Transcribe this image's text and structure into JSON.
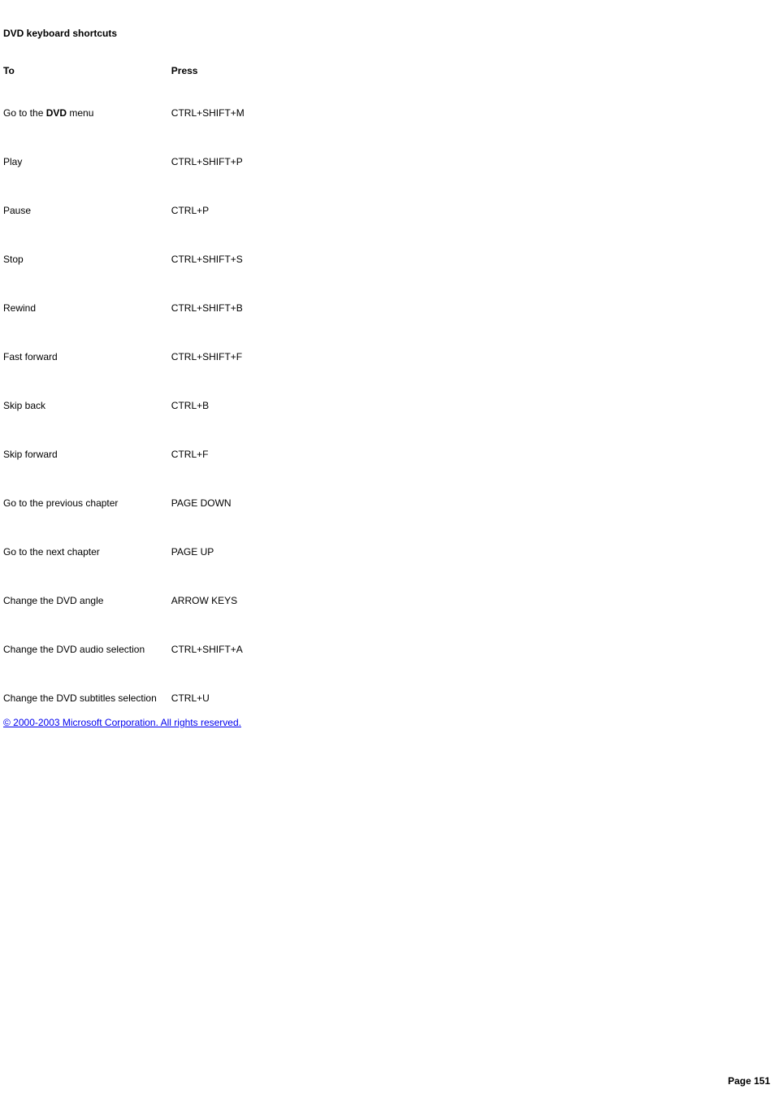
{
  "title": "DVD keyboard shortcuts",
  "table": {
    "headers": {
      "to": "To",
      "press": "Press"
    },
    "rows": [
      {
        "to_pre": "Go to the ",
        "to_bold": "DVD",
        "to_post": " menu",
        "press": "CTRL+SHIFT+M"
      },
      {
        "to_pre": "Play",
        "to_bold": "",
        "to_post": "",
        "press": "CTRL+SHIFT+P"
      },
      {
        "to_pre": "Pause",
        "to_bold": "",
        "to_post": "",
        "press": "CTRL+P"
      },
      {
        "to_pre": "Stop",
        "to_bold": "",
        "to_post": "",
        "press": "CTRL+SHIFT+S"
      },
      {
        "to_pre": "Rewind",
        "to_bold": "",
        "to_post": "",
        "press": "CTRL+SHIFT+B"
      },
      {
        "to_pre": "Fast forward",
        "to_bold": "",
        "to_post": "",
        "press": "CTRL+SHIFT+F"
      },
      {
        "to_pre": "Skip back",
        "to_bold": "",
        "to_post": "",
        "press": "CTRL+B"
      },
      {
        "to_pre": "Skip forward",
        "to_bold": "",
        "to_post": "",
        "press": "CTRL+F"
      },
      {
        "to_pre": "Go to the previous chapter",
        "to_bold": "",
        "to_post": "",
        "press": "PAGE DOWN"
      },
      {
        "to_pre": "Go to the next chapter",
        "to_bold": "",
        "to_post": "",
        "press": "PAGE UP"
      },
      {
        "to_pre": "Change the DVD angle",
        "to_bold": "",
        "to_post": "",
        "press": "ARROW KEYS"
      },
      {
        "to_pre": "Change the DVD audio selection",
        "to_bold": "",
        "to_post": "",
        "press": "CTRL+SHIFT+A"
      },
      {
        "to_pre": "Change the DVD subtitles selection",
        "to_bold": "",
        "to_post": "",
        "press": "CTRL+U"
      }
    ]
  },
  "copyright": "© 2000-2003 Microsoft Corporation. All rights reserved.",
  "page_number": "Page 151"
}
